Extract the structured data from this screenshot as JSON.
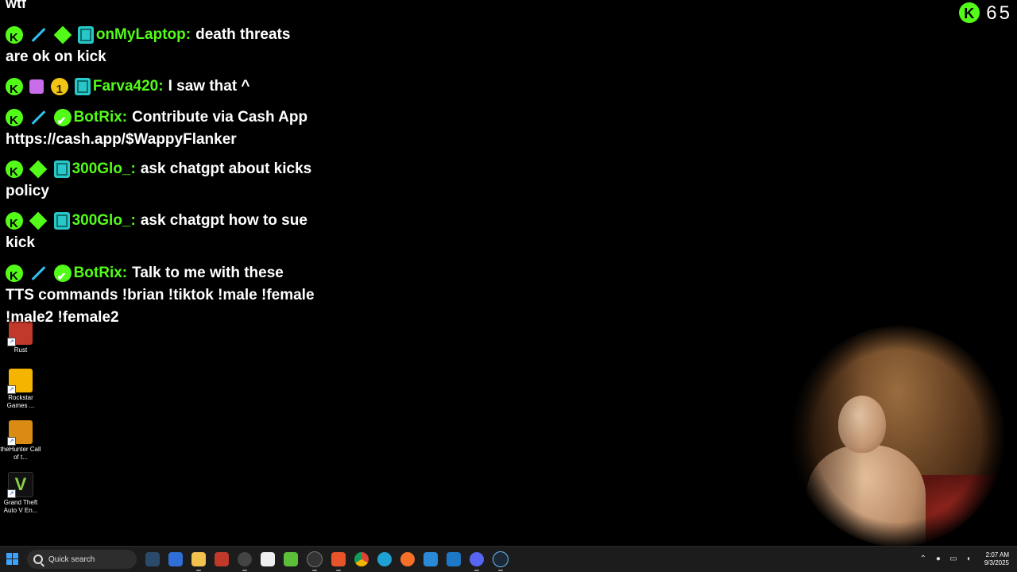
{
  "desktop_icons": [
    {
      "label": "Rust",
      "color": "#c0392b"
    },
    {
      "label": "Rockstar Games ...",
      "color": "#f5b400"
    },
    {
      "label": "theHunter Call of t...",
      "color": "#d98b14"
    },
    {
      "label": "Grand Theft Auto V En...",
      "color": "#111111"
    }
  ],
  "chat": {
    "top_fragment": "wtf",
    "messages": [
      {
        "username": "onMyLaptop",
        "text": "death threats are ok on kick"
      },
      {
        "username": "Farva420",
        "text": "I saw that ^"
      },
      {
        "username": "BotRix",
        "text": "Contribute via Cash App https://cash.app/$WappyFlanker"
      },
      {
        "username": "300Glo_",
        "text": "ask chatgpt about kicks policy"
      },
      {
        "username": "300Glo_",
        "text": "ask chatgpt how to sue kick"
      },
      {
        "username": "BotRix",
        "text": "Talk to me with these TTS commands !brian !tiktok !male !female !male2 !female2"
      }
    ]
  },
  "viewer_count": {
    "value": "65",
    "icon": "kick-logo-icon",
    "color": "#53fc18"
  },
  "taskbar": {
    "search_placeholder": "Quick search",
    "apps": [
      "widgets-icon",
      "store-icon",
      "file-explorer-icon",
      "news-icon",
      "clock-app-icon",
      "capcut-icon",
      "vpn-icon",
      "obs-icon",
      "brave-icon",
      "chrome-icon",
      "edge-icon",
      "firefox-icon",
      "gamebar-icon",
      "vscode-icon",
      "discord-icon",
      "steam-icon"
    ],
    "time": "2:07 AM",
    "date": "9/3/2025"
  },
  "colors": {
    "kick_green": "#53fc18",
    "taskbar_bg": "#1c1c1c"
  }
}
